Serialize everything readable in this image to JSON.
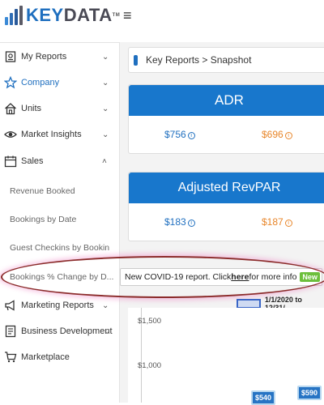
{
  "app": {
    "logo_text_part1": "KEY",
    "logo_text_part2": "DATA",
    "logo_tm": "TM",
    "menu_icon": "hamburger-icon"
  },
  "sidebar": {
    "items": [
      {
        "label": "My Reports",
        "icon": "reports-icon"
      },
      {
        "label": "Company",
        "icon": "star-icon"
      },
      {
        "label": "Units",
        "icon": "house-icon"
      },
      {
        "label": "Market Insights",
        "icon": "eye-icon"
      },
      {
        "label": "Sales",
        "icon": "calendar-icon"
      },
      {
        "label": "Marketing Reports",
        "icon": "megaphone-icon"
      },
      {
        "label": "Business Development",
        "icon": "document-icon"
      },
      {
        "label": "Marketplace",
        "icon": "cart-icon"
      }
    ],
    "sales_sub": [
      "Revenue Booked",
      "Bookings by Date",
      "Guest Checkins by Bookin",
      "Bookings % Change by D..."
    ]
  },
  "breadcrumb": "Key Reports > Snapshot",
  "cards": [
    {
      "title": "ADR",
      "value1": "$756",
      "value2": "$696"
    },
    {
      "title": "Adjusted RevPAR",
      "value1": "$183",
      "value2": "$187"
    }
  ],
  "tooltip": {
    "prefix": "New COVID-19 report. Click ",
    "link": "here",
    "suffix": " for more info",
    "badge": "New"
  },
  "chart": {
    "date_range": "1/1/2020 to 12/31/",
    "y_ticks": [
      "$1,500",
      "$1,000"
    ],
    "bar_labels": [
      "$540",
      "$590"
    ]
  },
  "colors": {
    "accent": "#1877cc",
    "orange": "#e8862a",
    "badge_green": "#6cbf3c"
  }
}
